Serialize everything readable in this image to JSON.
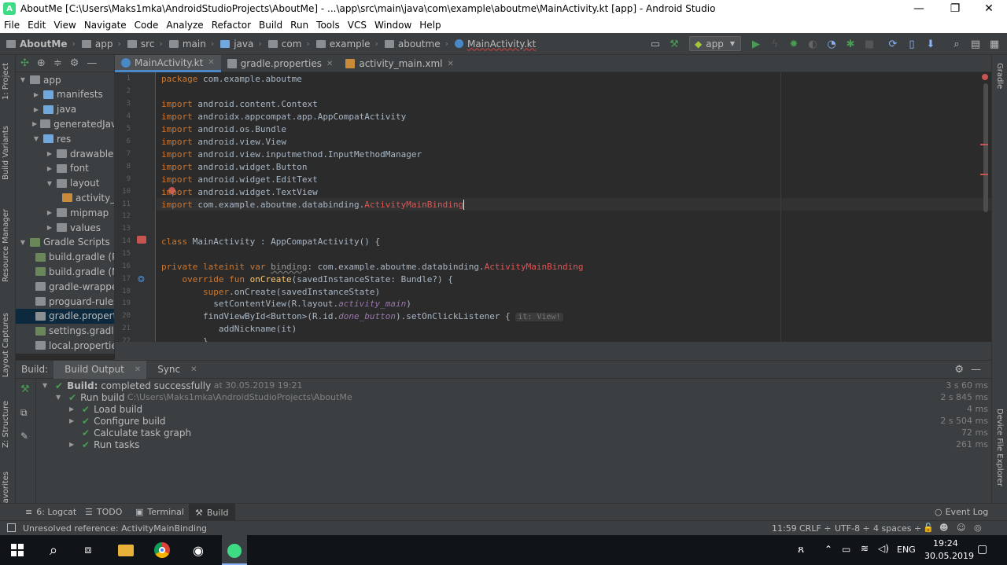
{
  "window": {
    "title": "AboutMe [C:\\Users\\Maks1mka\\AndroidStudioProjects\\AboutMe] - ...\\app\\src\\main\\java\\com\\example\\aboutme\\MainActivity.kt [app] - Android Studio",
    "minimize": "—",
    "maximize": "❐",
    "close": "✕"
  },
  "menu": [
    "File",
    "Edit",
    "View",
    "Navigate",
    "Code",
    "Analyze",
    "Refactor",
    "Build",
    "Run",
    "Tools",
    "VCS",
    "Window",
    "Help"
  ],
  "breadcrumbs": [
    "AboutMe",
    "app",
    "src",
    "main",
    "java",
    "com",
    "example",
    "aboutme",
    "MainActivity.kt"
  ],
  "toolbar": {
    "config": "app"
  },
  "stripes": {
    "left": [
      "1: Project",
      "Build Variants",
      "Resource Manager",
      "Layout Captures",
      "Z: Structure",
      "avorites"
    ],
    "right": [
      "Gradle",
      "Device File Explorer"
    ]
  },
  "project_tree": [
    {
      "label": "app",
      "indent": 0,
      "arrow": "▼",
      "color": "#8c8f91"
    },
    {
      "label": "manifests",
      "indent": 1,
      "arrow": "▶",
      "color": "#6fa8dc"
    },
    {
      "label": "java",
      "indent": 1,
      "arrow": "▶",
      "color": "#6fa8dc"
    },
    {
      "label": "generatedJava",
      "indent": 1,
      "arrow": "▶",
      "color": "#8c8f91"
    },
    {
      "label": "res",
      "indent": 1,
      "arrow": "▼",
      "color": "#6fa8dc"
    },
    {
      "label": "drawable",
      "indent": 2,
      "arrow": "▶",
      "color": "#8c8f91"
    },
    {
      "label": "font",
      "indent": 2,
      "arrow": "▶",
      "color": "#8c8f91"
    },
    {
      "label": "layout",
      "indent": 2,
      "arrow": "▼",
      "color": "#8c8f91"
    },
    {
      "label": "activity_",
      "indent": 3,
      "arrow": "",
      "color": "#c98a3b"
    },
    {
      "label": "mipmap",
      "indent": 2,
      "arrow": "▶",
      "color": "#8c8f91"
    },
    {
      "label": "values",
      "indent": 2,
      "arrow": "▶",
      "color": "#8c8f91"
    },
    {
      "label": "Gradle Scripts",
      "indent": 0,
      "arrow": "▼",
      "color": "#6a8759"
    },
    {
      "label": "build.gradle (P",
      "indent": 1,
      "arrow": "",
      "color": "#6a8759"
    },
    {
      "label": "build.gradle (M",
      "indent": 1,
      "arrow": "",
      "color": "#6a8759"
    },
    {
      "label": "gradle-wrappe",
      "indent": 1,
      "arrow": "",
      "color": "#8c8f91"
    },
    {
      "label": "proguard-rules",
      "indent": 1,
      "arrow": "",
      "color": "#8c8f91"
    },
    {
      "label": "gradle.propert",
      "indent": 1,
      "arrow": "",
      "color": "#8c8f91",
      "selected": true
    },
    {
      "label": "settings.gradle",
      "indent": 1,
      "arrow": "",
      "color": "#6a8759"
    },
    {
      "label": "local.propertie",
      "indent": 1,
      "arrow": "",
      "color": "#8c8f91"
    }
  ],
  "tabs": [
    {
      "label": "MainActivity.kt",
      "active": true,
      "icon_color": "#4a88c7"
    },
    {
      "label": "gradle.properties",
      "active": false,
      "icon_color": "#8c8f91"
    },
    {
      "label": "activity_main.xml",
      "active": false,
      "icon_color": "#c98a3b"
    }
  ],
  "editor": {
    "line_numbers": [
      "1",
      "2",
      "3",
      "4",
      "5",
      "6",
      "7",
      "8",
      "9",
      "10",
      "11",
      "12",
      "13",
      "14",
      "15",
      "16",
      "17",
      "18",
      "19",
      "20",
      "21",
      "22"
    ]
  },
  "build": {
    "tabs": [
      "Build:",
      "Build Output",
      "Sync"
    ],
    "rows": [
      {
        "text": "Build:",
        "bold": true,
        "extra": " completed successfully",
        "muted": " at 30.05.2019 19:21",
        "time": "3 s 60 ms",
        "level": 0,
        "arrow": "▼"
      },
      {
        "text": "Run build",
        "bold": false,
        "extra": "",
        "muted": " C:\\Users\\Maks1mka\\AndroidStudioProjects\\AboutMe",
        "time": "2 s 845 ms",
        "level": 1,
        "arrow": "▼"
      },
      {
        "text": "Load build",
        "bold": false,
        "extra": "",
        "muted": "",
        "time": "4 ms",
        "level": 2,
        "arrow": "▶"
      },
      {
        "text": "Configure build",
        "bold": false,
        "extra": "",
        "muted": "",
        "time": "2 s 504 ms",
        "level": 2,
        "arrow": "▶"
      },
      {
        "text": "Calculate task graph",
        "bold": false,
        "extra": "",
        "muted": "",
        "time": "72 ms",
        "level": 2,
        "arrow": ""
      },
      {
        "text": "Run tasks",
        "bold": false,
        "extra": "",
        "muted": "",
        "time": "261 ms",
        "level": 2,
        "arrow": "▶"
      }
    ]
  },
  "bottom_tools": [
    "6: Logcat",
    "TODO",
    "Terminal",
    "Build"
  ],
  "event_log": "Event Log",
  "status": {
    "message": "Unresolved reference: ActivityMainBinding",
    "position": "11:59",
    "line_sep": "CRLF ÷",
    "encoding": "UTF-8 ÷",
    "indent": "4 spaces ÷"
  },
  "taskbar": {
    "lang": "ENG",
    "time": "19:24",
    "date": "30.05.2019"
  }
}
